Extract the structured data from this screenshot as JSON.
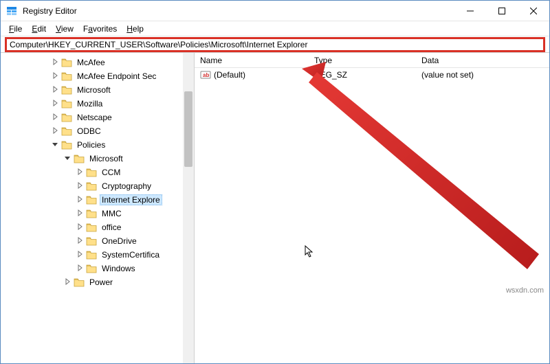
{
  "window": {
    "title": "Registry Editor",
    "min": "Minimize",
    "max": "Maximize",
    "close": "Close"
  },
  "menu": {
    "file": "File",
    "edit": "Edit",
    "view": "View",
    "favorites": "Favorites",
    "help": "Help"
  },
  "address": "Computer\\HKEY_CURRENT_USER\\Software\\Policies\\Microsoft\\Internet Explorer",
  "tree": [
    {
      "indent": 4,
      "expand": ">",
      "label": "McAfee",
      "selected": false
    },
    {
      "indent": 4,
      "expand": ">",
      "label": "McAfee Endpoint Sec",
      "selected": false
    },
    {
      "indent": 4,
      "expand": ">",
      "label": "Microsoft",
      "selected": false
    },
    {
      "indent": 4,
      "expand": ">",
      "label": "Mozilla",
      "selected": false
    },
    {
      "indent": 4,
      "expand": ">",
      "label": "Netscape",
      "selected": false
    },
    {
      "indent": 4,
      "expand": ">",
      "label": "ODBC",
      "selected": false
    },
    {
      "indent": 4,
      "expand": "v",
      "label": "Policies",
      "selected": false
    },
    {
      "indent": 5,
      "expand": "v",
      "label": "Microsoft",
      "selected": false
    },
    {
      "indent": 6,
      "expand": ">",
      "label": "CCM",
      "selected": false
    },
    {
      "indent": 6,
      "expand": ">",
      "label": "Cryptography",
      "selected": false
    },
    {
      "indent": 6,
      "expand": ">",
      "label": "Internet Explore",
      "selected": true
    },
    {
      "indent": 6,
      "expand": ">",
      "label": "MMC",
      "selected": false
    },
    {
      "indent": 6,
      "expand": ">",
      "label": "office",
      "selected": false
    },
    {
      "indent": 6,
      "expand": ">",
      "label": "OneDrive",
      "selected": false
    },
    {
      "indent": 6,
      "expand": ">",
      "label": "SystemCertifica",
      "selected": false
    },
    {
      "indent": 6,
      "expand": ">",
      "label": "Windows",
      "selected": false
    },
    {
      "indent": 5,
      "expand": ">",
      "label": "Power",
      "selected": false
    }
  ],
  "list": {
    "headers": {
      "name": "Name",
      "type": "Type",
      "data": "Data"
    },
    "rows": [
      {
        "name": "(Default)",
        "type": "REG_SZ",
        "data": "(value not set)"
      }
    ]
  },
  "watermark": "wsxdn.com"
}
